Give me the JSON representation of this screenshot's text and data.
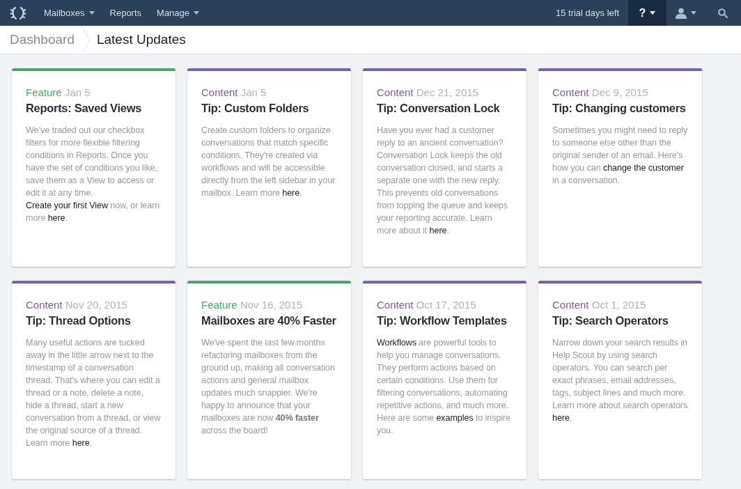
{
  "nav": {
    "items": [
      {
        "label": "Mailboxes",
        "dropdown": true
      },
      {
        "label": "Reports",
        "dropdown": false
      },
      {
        "label": "Manage",
        "dropdown": true
      }
    ],
    "trial": "15 trial days left",
    "help": "?"
  },
  "breadcrumb": [
    "Dashboard",
    "Latest Updates"
  ],
  "cards": [
    {
      "category": "Feature",
      "color": "#48a868",
      "date": "Jan 5",
      "title": "Reports: Saved Views",
      "body": [
        {
          "kind": "text",
          "text": "We’ve traded out our checkbox filters for more flexible filtering conditions in Reports. Once you have the set of conditions you like, save them as a View to access or edit it at any time. "
        },
        {
          "kind": "link",
          "text": "Create your first View"
        },
        {
          "kind": "text",
          "text": " now, or learn more "
        },
        {
          "kind": "link",
          "text": "here"
        },
        {
          "kind": "text",
          "text": "."
        }
      ]
    },
    {
      "category": "Content",
      "color": "#7b5ea7",
      "date": "Jan 5",
      "title": "Tip: Custom Folders",
      "body": [
        {
          "kind": "text",
          "text": "Create custom folders to organize conversations that match specific conditions. They're created via workflows and will be accessible directly from the left sidebar in your mailbox. Learn more "
        },
        {
          "kind": "link",
          "text": "here"
        },
        {
          "kind": "text",
          "text": "."
        }
      ]
    },
    {
      "category": "Content",
      "color": "#7b5ea7",
      "date": "Dec 21, 2015",
      "title": "Tip: Conversation Lock",
      "body": [
        {
          "kind": "text",
          "text": "Have you ever had a customer reply to an ancient conversation? Conversation Lock keeps the old conversation closed, and starts a separate one with the new reply. This prevents old conversations from topping the queue and keeps your reporting accurate. Learn more about it "
        },
        {
          "kind": "link",
          "text": "here"
        },
        {
          "kind": "text",
          "text": "."
        }
      ]
    },
    {
      "category": "Content",
      "color": "#7b5ea7",
      "date": "Dec 9, 2015",
      "title": "Tip: Changing customers",
      "body": [
        {
          "kind": "text",
          "text": "Sometimes you might need to reply to someone else other than the original sender of an email. Here's how you can "
        },
        {
          "kind": "link",
          "text": "change the customer"
        },
        {
          "kind": "text",
          "text": " in a conversation."
        }
      ]
    },
    {
      "category": "Content",
      "color": "#7b5ea7",
      "date": "Nov 20, 2015",
      "title": "Tip: Thread Options",
      "body": [
        {
          "kind": "text",
          "text": "Many useful actions are tucked away in the little arrow next to the timestamp of a conversation thread. That's where you can edit a thread or a note, delete a note, hide a thread, start a new conversation from a thread, or view the original source of a thread. Learn more "
        },
        {
          "kind": "link",
          "text": "here"
        },
        {
          "kind": "text",
          "text": "."
        }
      ]
    },
    {
      "category": "Feature",
      "color": "#48a868",
      "date": "Nov 16, 2015",
      "title": "Mailboxes are 40% Faster",
      "body": [
        {
          "kind": "text",
          "text": "We've spent the last few months refactoring mailboxes from the ground up, making all conversation actions and general mailbox updates much snappier. We're happy to announce that your mailboxes are now "
        },
        {
          "kind": "bold",
          "text": "40% faster"
        },
        {
          "kind": "text",
          "text": " across the board!"
        }
      ]
    },
    {
      "category": "Content",
      "color": "#7b5ea7",
      "date": "Oct 17, 2015",
      "title": "Tip: Workflow Templates",
      "body": [
        {
          "kind": "link",
          "text": "Workflows"
        },
        {
          "kind": "text",
          "text": " are powerful tools to help you manage conversations. They perform actions based on certain conditions. Use them for filtering conversations, automating repetitive actions, and much more. Here are some "
        },
        {
          "kind": "link",
          "text": "examples"
        },
        {
          "kind": "text",
          "text": " to inspire you."
        }
      ]
    },
    {
      "category": "Content",
      "color": "#7b5ea7",
      "date": "Oct 1, 2015",
      "title": "Tip: Search Operators",
      "body": [
        {
          "kind": "text",
          "text": "Narrow down your search results in Help Scout by using search operators. You can search per exact phrases, email addresses, tags, subject lines and much more. Learn more about search operators "
        },
        {
          "kind": "link",
          "text": "here"
        },
        {
          "kind": "text",
          "text": "."
        }
      ]
    }
  ]
}
